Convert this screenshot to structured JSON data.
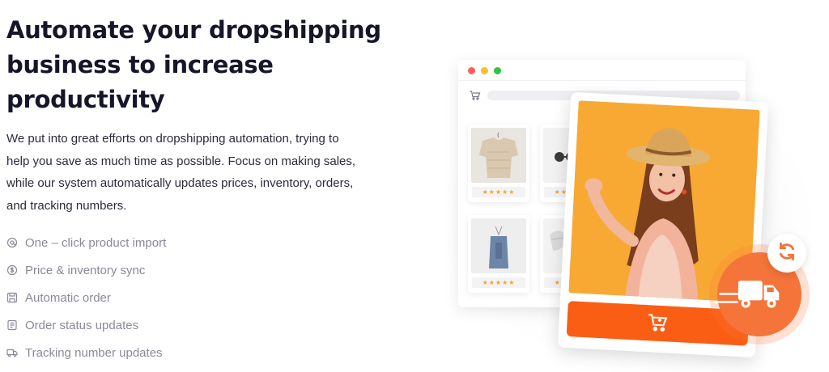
{
  "hero": {
    "headline_lines": [
      "Automate your dropshipping",
      "business to increase",
      "productivity"
    ],
    "description_lines": [
      "We put into great efforts on dropshipping automation, trying to",
      "help you save as much time as possible. Focus on making sales,",
      "while our system automatically updates prices, inventory, orders,",
      "and tracking numbers."
    ]
  },
  "features": [
    {
      "icon": "link-icon",
      "label": "One – click product import"
    },
    {
      "icon": "dollar-circle-icon",
      "label": "Price & inventory sync"
    },
    {
      "icon": "save-order-icon",
      "label": "Automatic order"
    },
    {
      "icon": "document-icon",
      "label": "Order status updates"
    },
    {
      "icon": "truck-icon",
      "label": "Tracking number updates"
    }
  ],
  "illustration": {
    "product_ratings": [
      "★★★★★",
      "★★★★★",
      "★★★★★",
      "★★★★★"
    ],
    "icons": [
      "cart-icon",
      "truck-icon",
      "sync-icon"
    ]
  },
  "colors": {
    "accent": "#fa5e15",
    "card_bg": "#f7a934",
    "heading": "#16162a",
    "muted": "#8a8a96",
    "star": "#f5a623"
  }
}
